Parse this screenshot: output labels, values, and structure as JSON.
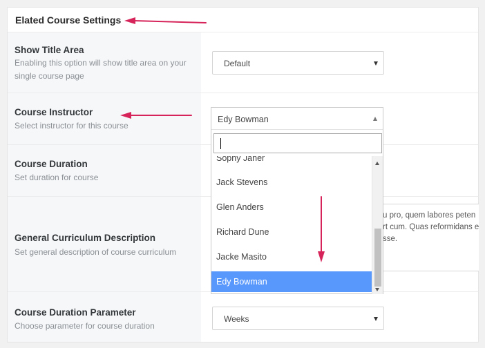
{
  "panel": {
    "title": "Elated Course Settings"
  },
  "rows": {
    "show_title_area": {
      "label": "Show Title Area",
      "desc": "Enabling this option will show title area on your single course page",
      "value": "Default"
    },
    "course_instructor": {
      "label": "Course Instructor",
      "desc": "Select instructor for this course",
      "value": "Edy Bowman"
    },
    "course_duration": {
      "label": "Course Duration",
      "desc": "Set duration for course"
    },
    "curriculum": {
      "label": "General Curriculum Description",
      "desc": "Set general description of course curriculum",
      "text_lines": [
        "u pro, quem labores peten",
        "rt cum. Quas reformidans e",
        "sse."
      ]
    },
    "duration_parameter": {
      "label": "Course Duration Parameter",
      "desc": "Choose parameter for course duration",
      "value": "Weeks"
    }
  },
  "dropdown": {
    "search_value": "",
    "items": [
      "Sophy Janer",
      "Jack Stevens",
      "Glen Anders",
      "Richard Dune",
      "Jacke Masito",
      "Edy Bowman"
    ],
    "selected": "Edy Bowman"
  },
  "annotation_color": "#d6245a"
}
